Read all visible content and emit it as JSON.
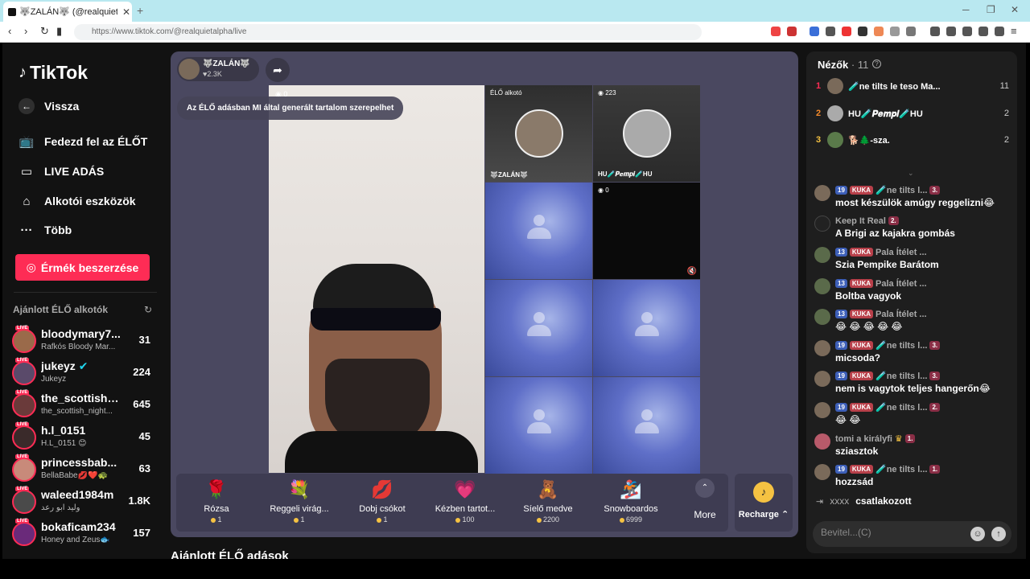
{
  "browser": {
    "tab_title": "🐺ZALÁN🐺 (@realquietalpha",
    "url": "https://www.tiktok.com/@realquietalpha/live"
  },
  "sidebar": {
    "logo": "TikTok",
    "back": "Vissza",
    "explore_live": "Fedezd fel az ÉLŐT",
    "live_studio": "LIVE ADÁS",
    "creator_tools": "Alkotói eszközök",
    "more": "Több",
    "get_coins": "Érmék beszerzése",
    "recommended_title": "Ajánlott ÉLŐ alkotók",
    "live_badge": "LIVE",
    "creators": [
      {
        "name": "bloodymary7...",
        "sub": "Rafkós Bloody Mar...",
        "count": "31"
      },
      {
        "name": "jukeyz",
        "sub": "Jukeyz",
        "count": "224"
      },
      {
        "name": "the_scottish_...",
        "sub": "the_scottish_night...",
        "count": "645"
      },
      {
        "name": "h.l_0151",
        "sub": "H.L_0151 😊",
        "count": "45"
      },
      {
        "name": "princessbab...",
        "sub": "BellaBabe💋❤️🐢",
        "count": "63"
      },
      {
        "name": "waleed1984m",
        "sub": "وليد ابو رعد",
        "count": "1.8K"
      },
      {
        "name": "bokaficam234",
        "sub": "Honey and Zeus🐟",
        "count": "157"
      }
    ]
  },
  "stream": {
    "host_name": "🐺ZALÁN🐺",
    "host_likes": "♥2.3K",
    "ai_notice": "Az ÉLŐ adásban MI által generált tartalom szerepelhet",
    "main_viewers": "0",
    "cells": {
      "host_label": "ÉLŐ alkotó",
      "host_name": "🐺ZALÁN🐺",
      "guest_viewers": "223",
      "guest_name": "HU🧪𝑷𝒆𝒎𝒑𝒊🧪HU",
      "dark_viewers": "0"
    },
    "below_title": "Ajánlott ÉLŐ adások"
  },
  "gifts": [
    {
      "name": "Rózsa",
      "price": "1",
      "icon": "🌹"
    },
    {
      "name": "Reggeli virág...",
      "price": "1",
      "icon": "💐"
    },
    {
      "name": "Dobj csókot",
      "price": "1",
      "icon": "💋"
    },
    {
      "name": "Kézben tartot...",
      "price": "100",
      "icon": "💗"
    },
    {
      "name": "Síelő medve",
      "price": "2200",
      "icon": "🧸"
    },
    {
      "name": "Snowboardos",
      "price": "6999",
      "icon": "🏂"
    }
  ],
  "gift_more": "More",
  "recharge": "Recharge ⌃",
  "chat": {
    "viewers_label": "Nézők",
    "viewers_count": "· 11",
    "top_viewers": [
      {
        "rank": "1",
        "name": "🧪ne tilts le teso Ma...",
        "score": "11"
      },
      {
        "rank": "2",
        "name": "HU🧪𝑷𝒆𝒎𝒑𝒊🧪HU",
        "score": "2"
      },
      {
        "rank": "3",
        "name": "🐕🌲-sza.",
        "score": "2"
      }
    ],
    "messages": [
      {
        "lvl": "19",
        "team": "KUKA",
        "name": "🧪ne tilts l...",
        "fan": "3.",
        "text": "most készülök amúgy reggelizni😂"
      },
      {
        "lvl": "",
        "team": "",
        "name": "Keep It Real",
        "fan": "2.",
        "text": "A Brigi az kajakra gombás"
      },
      {
        "lvl": "13",
        "team": "KUKA",
        "name": "Pala Ítélet ...",
        "fan": "",
        "text": "Szia Pempike Barátom"
      },
      {
        "lvl": "13",
        "team": "KUKA",
        "name": "Pala Ítélet ...",
        "fan": "",
        "text": "Boltba vagyok"
      },
      {
        "lvl": "13",
        "team": "KUKA",
        "name": "Pala Ítélet ...",
        "fan": "",
        "text": "😂 😂 😂 😂 😂"
      },
      {
        "lvl": "19",
        "team": "KUKA",
        "name": "🧪ne tilts l...",
        "fan": "3.",
        "text": "micsoda?"
      },
      {
        "lvl": "19",
        "team": "KUKA",
        "name": "🧪ne tilts l...",
        "fan": "3.",
        "text": "nem is vagytok teljes hangerőn😂"
      },
      {
        "lvl": "19",
        "team": "KUKA",
        "name": "🧪ne tilts l...",
        "fan": "2.",
        "text": "😂 😂"
      },
      {
        "lvl": "",
        "team": "",
        "name": "tomi a királyfi",
        "fan": "1.",
        "text": "sziasztok"
      },
      {
        "lvl": "19",
        "team": "KUKA",
        "name": "🧪ne tilts l...",
        "fan": "1.",
        "text": "hozzsád"
      }
    ],
    "join_user": "xxxx",
    "join_text": "csatlakozott",
    "input_placeholder": "Bevitel...(C)"
  }
}
